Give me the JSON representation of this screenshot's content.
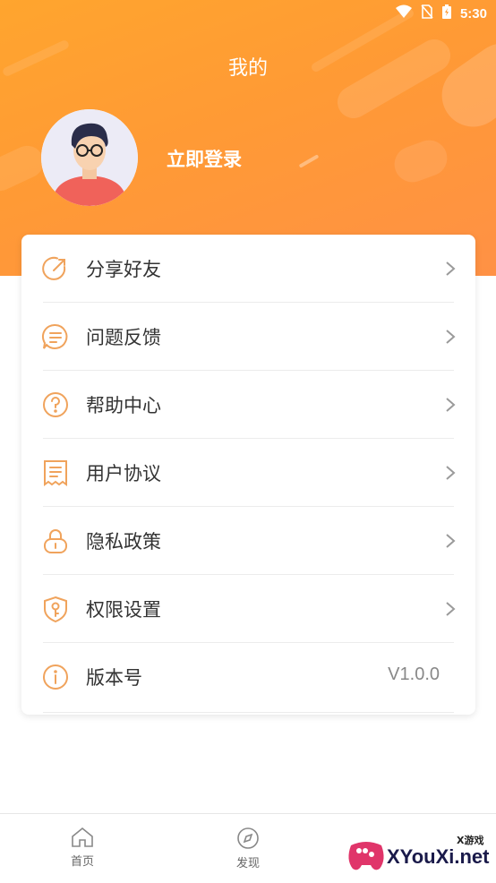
{
  "status_bar": {
    "time": "5:30"
  },
  "header": {
    "title": "我的",
    "login_label": "立即登录"
  },
  "menu": [
    {
      "label": "分享好友",
      "icon": "share-icon"
    },
    {
      "label": "问题反馈",
      "icon": "feedback-icon"
    },
    {
      "label": "帮助中心",
      "icon": "help-icon"
    },
    {
      "label": "用户协议",
      "icon": "agreement-icon"
    },
    {
      "label": "隐私政策",
      "icon": "lock-icon"
    },
    {
      "label": "权限设置",
      "icon": "shield-key-icon"
    },
    {
      "label": "版本号",
      "icon": "info-icon",
      "value": "V1.0.0"
    }
  ],
  "tabs": [
    {
      "label": "首页",
      "icon": "home-icon"
    },
    {
      "label": "发现",
      "icon": "compass-icon"
    }
  ],
  "watermark": {
    "text": "XYouXi.net",
    "small": "X游戏"
  },
  "colors": {
    "accent": "#ff9f3a",
    "icon": "#f0a35c"
  }
}
